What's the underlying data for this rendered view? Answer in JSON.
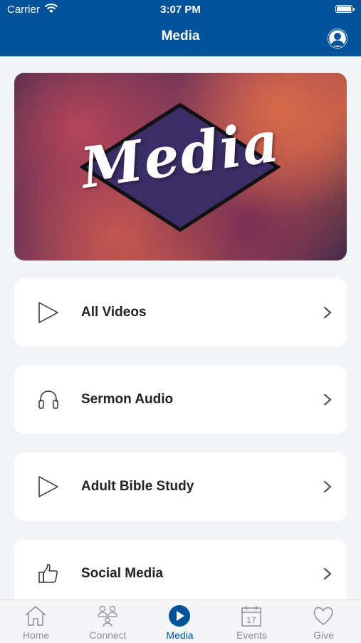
{
  "status_bar": {
    "carrier": "Carrier",
    "time": "3:07 PM"
  },
  "header": {
    "title": "Media"
  },
  "banner": {
    "text": "Media"
  },
  "menu": [
    {
      "label": "All Videos",
      "icon": "play-icon"
    },
    {
      "label": "Sermon Audio",
      "icon": "headphones-icon"
    },
    {
      "label": "Adult Bible Study",
      "icon": "play-icon"
    },
    {
      "label": "Social Media",
      "icon": "thumbs-up-icon"
    }
  ],
  "tabs": [
    {
      "label": "Home",
      "icon": "home-icon"
    },
    {
      "label": "Connect",
      "icon": "people-icon"
    },
    {
      "label": "Media",
      "icon": "play-circle-icon",
      "active": true
    },
    {
      "label": "Events",
      "icon": "calendar-icon",
      "badge": "17"
    },
    {
      "label": "Give",
      "icon": "heart-icon"
    }
  ],
  "colors": {
    "brand": "#00529b",
    "background": "#f3f4f8",
    "inactive_tab": "#8e8e93"
  }
}
